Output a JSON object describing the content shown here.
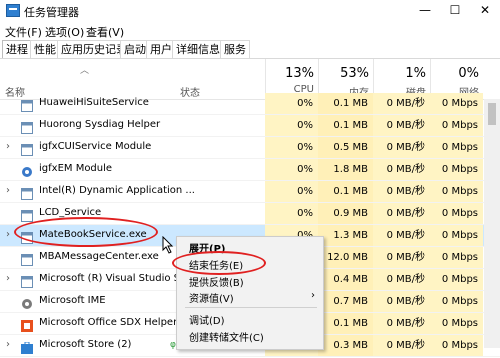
{
  "window": {
    "title": "任务管理器",
    "controls": {
      "minimize": "—",
      "maximize": "☐",
      "close": "✕"
    }
  },
  "menubar": {
    "items": [
      "文件(F)",
      "选项(O)",
      "查看(V)"
    ]
  },
  "tabs": [
    "进程",
    "性能",
    "应用历史记录",
    "启动",
    "用户",
    "详细信息",
    "服务"
  ],
  "columns": {
    "name": "名称",
    "status": "状态",
    "cpu": {
      "percent": "13%",
      "label": "CPU"
    },
    "memory": {
      "percent": "53%",
      "label": "内存"
    },
    "disk": {
      "percent": "1%",
      "label": "磁盘"
    },
    "network": {
      "percent": "0%",
      "label": "网络"
    }
  },
  "processes": [
    {
      "name": "HuaweiHiSuiteService",
      "icon": "service-window-icon",
      "cpu": "0%",
      "memory": "0.1 MB",
      "disk": "0 MB/秒",
      "network": "0 Mbps",
      "expand": false
    },
    {
      "name": "Huorong Sysdiag Helper",
      "icon": "service-window-icon",
      "cpu": "0%",
      "memory": "0.1 MB",
      "disk": "0 MB/秒",
      "network": "0 Mbps",
      "expand": false
    },
    {
      "name": "igfxCUIService Module",
      "icon": "service-window-icon",
      "cpu": "0%",
      "memory": "0.5 MB",
      "disk": "0 MB/秒",
      "network": "0 Mbps",
      "expand": true
    },
    {
      "name": "igfxEM Module",
      "icon": "intel-gear-icon",
      "cpu": "0%",
      "memory": "1.8 MB",
      "disk": "0 MB/秒",
      "network": "0 Mbps",
      "expand": false
    },
    {
      "name": "Intel(R) Dynamic Application ...",
      "icon": "service-window-icon",
      "cpu": "0%",
      "memory": "0.1 MB",
      "disk": "0 MB/秒",
      "network": "0 Mbps",
      "expand": true
    },
    {
      "name": "LCD_Service",
      "icon": "service-window-icon",
      "cpu": "0%",
      "memory": "0.9 MB",
      "disk": "0 MB/秒",
      "network": "0 Mbps",
      "expand": false
    },
    {
      "name": "MateBookService.exe",
      "icon": "service-window-icon",
      "cpu": "0%",
      "memory": "1.3 MB",
      "disk": "0 MB/秒",
      "network": "0 Mbps",
      "expand": true,
      "selected": true
    },
    {
      "name": "MBAMessageCenter.exe",
      "icon": "service-window-icon",
      "cpu": "",
      "memory": "12.0 MB",
      "disk": "0 MB/秒",
      "network": "0 Mbps",
      "expand": false
    },
    {
      "name": "Microsoft (R) Visual Studio S",
      "icon": "service-window-icon",
      "cpu": "",
      "memory": "0.4 MB",
      "disk": "0 MB/秒",
      "network": "0 Mbps",
      "expand": true
    },
    {
      "name": "Microsoft IME",
      "icon": "ime-gear-icon",
      "cpu": "",
      "memory": "0.7 MB",
      "disk": "0 MB/秒",
      "network": "0 Mbps",
      "expand": false
    },
    {
      "name": "Microsoft Office SDX Helper",
      "icon": "office-icon",
      "cpu": "",
      "memory": "0.1 MB",
      "disk": "0 MB/秒",
      "network": "0 Mbps",
      "expand": false
    },
    {
      "name": "Microsoft Store (2)",
      "icon": "store-icon",
      "cpu": "",
      "memory": "0.3 MB",
      "disk": "0 MB/秒",
      "network": "0 Mbps",
      "expand": true,
      "leaf": "φ"
    }
  ],
  "context_menu": {
    "expand": "展开(P)",
    "end_task": "结束任务(E)",
    "feedback": "提供反馈(B)",
    "resource_values": "资源值(V)",
    "debug": "调试(D)",
    "create_dump": "创建转储文件(C)",
    "submenu_arrow": "›"
  },
  "colors": {
    "selected_row": "#cce8ff",
    "heat_cell": "#fff4c4",
    "highlight_oval": "#e02020"
  }
}
